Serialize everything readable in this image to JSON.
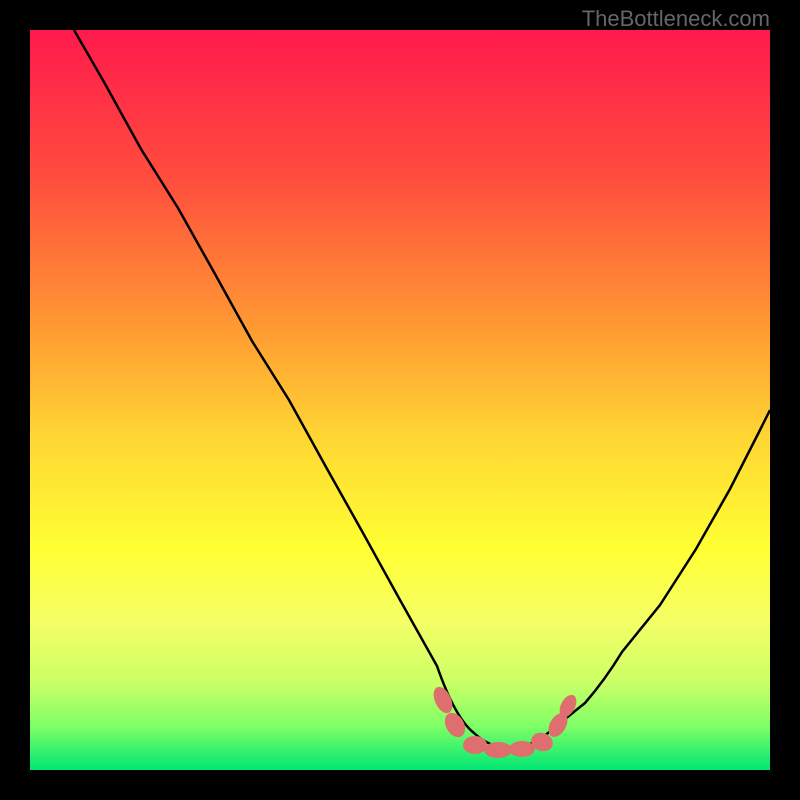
{
  "watermark": "TheBottleneck.com",
  "chart_data": {
    "type": "line",
    "title": "",
    "xlabel": "",
    "ylabel": "",
    "xlim": [
      0,
      100
    ],
    "ylim": [
      0,
      100
    ],
    "background_gradient_stops": [
      {
        "offset": 0,
        "color": "#ff1a4d"
      },
      {
        "offset": 20,
        "color": "#ff4d3d"
      },
      {
        "offset": 40,
        "color": "#ff9933"
      },
      {
        "offset": 55,
        "color": "#ffd633"
      },
      {
        "offset": 70,
        "color": "#ffff33"
      },
      {
        "offset": 80,
        "color": "#f5ff66"
      },
      {
        "offset": 88,
        "color": "#ccff66"
      },
      {
        "offset": 94,
        "color": "#80ff66"
      },
      {
        "offset": 100,
        "color": "#00e673"
      }
    ],
    "series": [
      {
        "name": "bottleneck-curve",
        "color": "#000000",
        "x": [
          6,
          10,
          15,
          20,
          25,
          30,
          35,
          40,
          45,
          50,
          55,
          58,
          60,
          63,
          67,
          70,
          74,
          78,
          82,
          86,
          90,
          94,
          98,
          100
        ],
        "y": [
          100,
          93,
          84,
          76,
          67,
          58,
          50,
          41,
          32,
          23,
          14,
          8,
          5,
          3,
          3,
          3,
          5,
          9,
          15,
          22,
          30,
          38,
          46,
          50
        ]
      }
    ],
    "markers": [
      {
        "name": "highlight-region",
        "color": "#e27070",
        "x_range": [
          55,
          72
        ],
        "y": 3
      }
    ]
  }
}
